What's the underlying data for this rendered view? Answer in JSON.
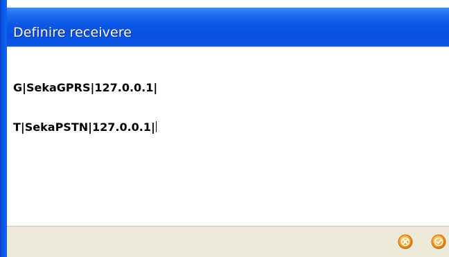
{
  "window": {
    "title": "Definire receivere"
  },
  "editor": {
    "lines": [
      "G|SekaGPRS|127.0.0.1|",
      "T|SekaPSTN|127.0.0.1|"
    ]
  },
  "actions": {
    "cancel_icon": "cancel-circle-icon",
    "ok_icon": "check-circle-icon"
  },
  "colors": {
    "title_bar": "#0b57e4",
    "status_bar": "#ece9d8",
    "button_orange": "#f59a1b"
  }
}
